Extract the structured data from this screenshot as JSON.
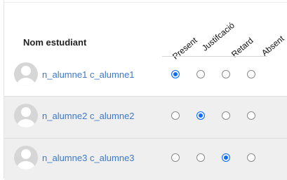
{
  "header": {
    "name_column": "Nom estudiant",
    "status_columns": [
      "Present",
      "Justifcació",
      "Retard",
      "Absent"
    ]
  },
  "students": [
    {
      "name": "n_alumne1 c_alumne1",
      "selected": "Present"
    },
    {
      "name": "n_alumne2 c_alumne2",
      "selected": "Justifcació"
    },
    {
      "name": "n_alumne3 c_alumne3",
      "selected": "Retard"
    }
  ],
  "colors": {
    "link": "#3d79c7",
    "accent": "#0d6efd",
    "alt_row": "#efefef"
  }
}
